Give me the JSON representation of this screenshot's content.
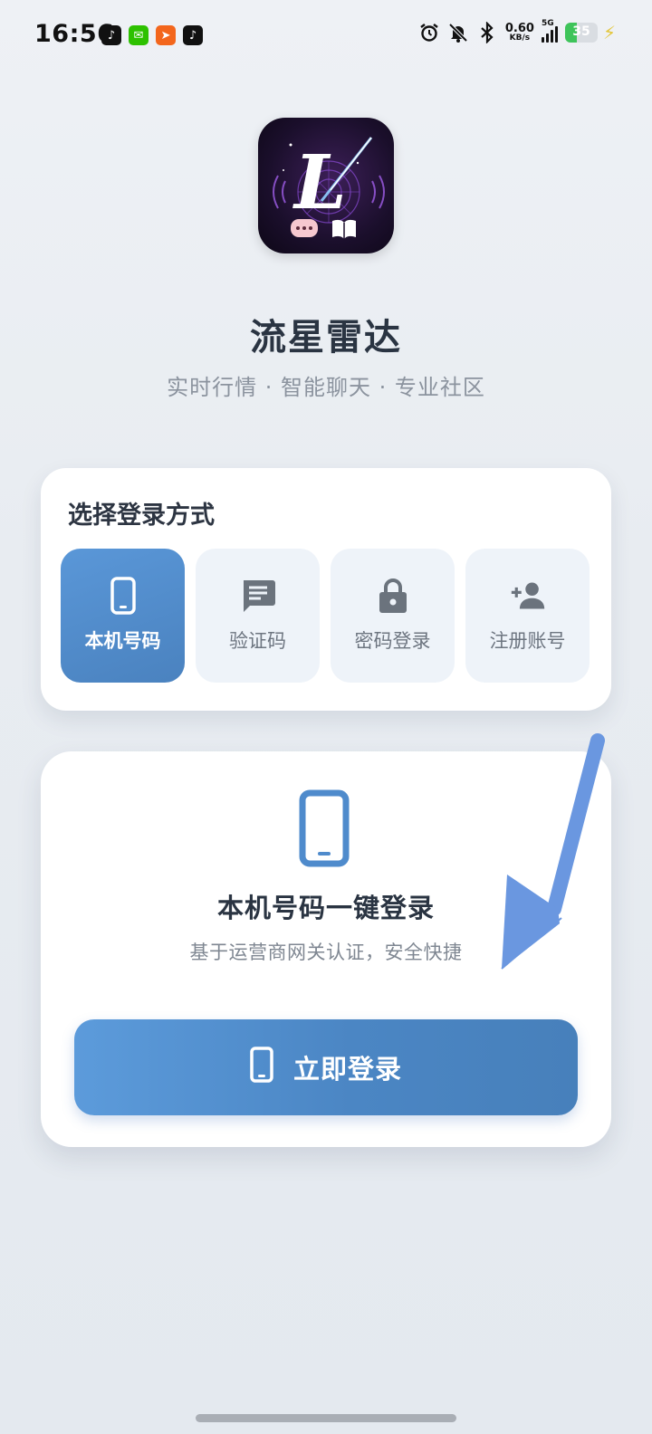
{
  "status_bar": {
    "time": "16:56",
    "net_speed_value": "0.60",
    "net_speed_unit": "KB/s",
    "network_type": "5G",
    "battery_percent": "35",
    "battery_level": 0.35
  },
  "app": {
    "name": "流星雷达",
    "tagline": "实时行情 · 智能聊天 · 专业社区"
  },
  "login_methods": {
    "title": "选择登录方式",
    "items": [
      {
        "label": "本机号码",
        "icon": "phone-icon",
        "active": true
      },
      {
        "label": "验证码",
        "icon": "message-icon",
        "active": false
      },
      {
        "label": "密码登录",
        "icon": "lock-icon",
        "active": false
      },
      {
        "label": "注册账号",
        "icon": "add-user-icon",
        "active": false
      }
    ]
  },
  "login_panel": {
    "title": "本机号码一键登录",
    "subtitle": "基于运营商网关认证，安全快捷",
    "button_label": "立即登录"
  },
  "colors": {
    "accent": "#4f8bcc",
    "arrow": "#6a97e0",
    "battery_green": "#3ec45a"
  }
}
